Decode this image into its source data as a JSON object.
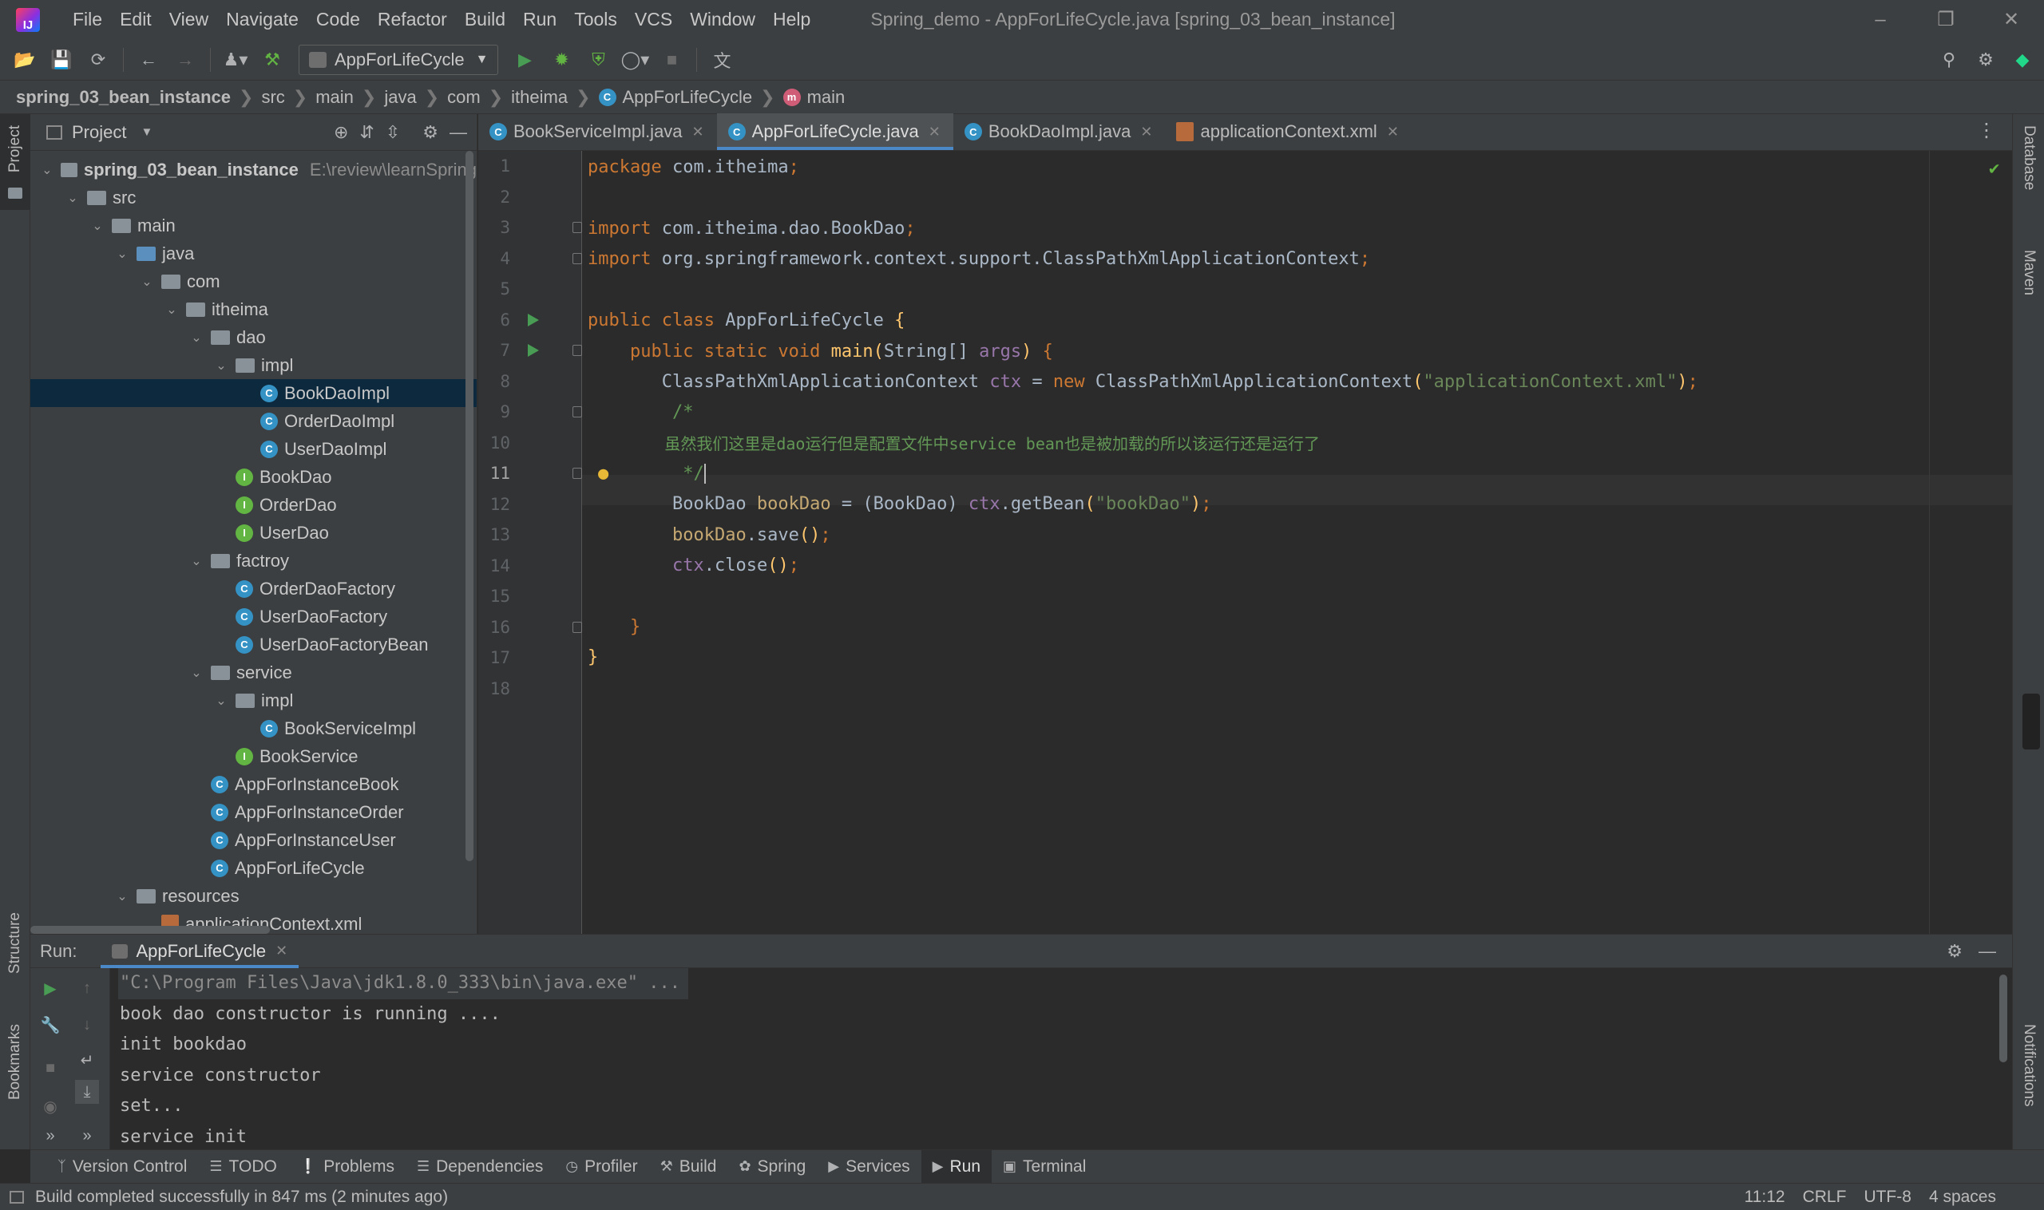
{
  "window": {
    "title": "Spring_demo - AppForLifeCycle.java [spring_03_bean_instance]",
    "menu": [
      "File",
      "Edit",
      "View",
      "Navigate",
      "Code",
      "Refactor",
      "Build",
      "Run",
      "Tools",
      "VCS",
      "Window",
      "Help"
    ]
  },
  "toolbar": {
    "run_config": "AppForLifeCycle"
  },
  "breadcrumb": [
    "spring_03_bean_instance",
    "src",
    "main",
    "java",
    "com",
    "itheima",
    "AppForLifeCycle",
    "main"
  ],
  "left_stripe": {
    "project": "Project",
    "structure": "Structure",
    "bookmarks": "Bookmarks"
  },
  "right_stripe": {
    "database": "Database",
    "maven": "Maven",
    "notifications": "Notifications"
  },
  "project": {
    "title": "Project",
    "root_name": "spring_03_bean_instance",
    "root_path": "E:\\review\\learnSpring",
    "tree": [
      {
        "label": "src",
        "indent": 1,
        "type": "folder",
        "open": true
      },
      {
        "label": "main",
        "indent": 2,
        "type": "folder",
        "open": true
      },
      {
        "label": "java",
        "indent": 3,
        "type": "folder-blue",
        "open": true
      },
      {
        "label": "com",
        "indent": 4,
        "type": "folder",
        "open": true
      },
      {
        "label": "itheima",
        "indent": 5,
        "type": "folder",
        "open": true
      },
      {
        "label": "dao",
        "indent": 6,
        "type": "folder",
        "open": true
      },
      {
        "label": "impl",
        "indent": 7,
        "type": "folder",
        "open": true
      },
      {
        "label": "BookDaoImpl",
        "indent": 8,
        "type": "class",
        "selected": true
      },
      {
        "label": "OrderDaoImpl",
        "indent": 8,
        "type": "class"
      },
      {
        "label": "UserDaoImpl",
        "indent": 8,
        "type": "class"
      },
      {
        "label": "BookDao",
        "indent": 7,
        "type": "interface"
      },
      {
        "label": "OrderDao",
        "indent": 7,
        "type": "interface"
      },
      {
        "label": "UserDao",
        "indent": 7,
        "type": "interface"
      },
      {
        "label": "factroy",
        "indent": 6,
        "type": "folder",
        "open": true
      },
      {
        "label": "OrderDaoFactory",
        "indent": 7,
        "type": "class"
      },
      {
        "label": "UserDaoFactory",
        "indent": 7,
        "type": "class"
      },
      {
        "label": "UserDaoFactoryBean",
        "indent": 7,
        "type": "class"
      },
      {
        "label": "service",
        "indent": 6,
        "type": "folder",
        "open": true
      },
      {
        "label": "impl",
        "indent": 7,
        "type": "folder",
        "open": true
      },
      {
        "label": "BookServiceImpl",
        "indent": 8,
        "type": "class"
      },
      {
        "label": "BookService",
        "indent": 7,
        "type": "interface"
      },
      {
        "label": "AppForInstanceBook",
        "indent": 6,
        "type": "class"
      },
      {
        "label": "AppForInstanceOrder",
        "indent": 6,
        "type": "class"
      },
      {
        "label": "AppForInstanceUser",
        "indent": 6,
        "type": "class"
      },
      {
        "label": "AppForLifeCycle",
        "indent": 6,
        "type": "class"
      },
      {
        "label": "resources",
        "indent": 3,
        "type": "folder",
        "open": true
      },
      {
        "label": "applicationContext.xml",
        "indent": 4,
        "type": "xml"
      }
    ]
  },
  "editor": {
    "tabs": [
      {
        "label": "BookServiceImpl.java",
        "active": false,
        "icon": "class"
      },
      {
        "label": "AppForLifeCycle.java",
        "active": true,
        "icon": "class"
      },
      {
        "label": "BookDaoImpl.java",
        "active": false,
        "icon": "class"
      },
      {
        "label": "applicationContext.xml",
        "active": false,
        "icon": "xml"
      }
    ],
    "current_line": 11,
    "line_numbers": [
      "1",
      "2",
      "3",
      "4",
      "5",
      "6",
      "7",
      "8",
      "9",
      "10",
      "11",
      "12",
      "13",
      "14",
      "15",
      "16",
      "17",
      "18"
    ]
  },
  "run": {
    "label": "Run:",
    "tab": "AppForLifeCycle",
    "console": [
      "\"C:\\Program Files\\Java\\jdk1.8.0_333\\bin\\java.exe\" ...",
      "book dao constructor is running ....",
      "init bookdao",
      "service constructor",
      "set...",
      "service init"
    ]
  },
  "bottom_tools": [
    "Version Control",
    "TODO",
    "Problems",
    "Dependencies",
    "Profiler",
    "Build",
    "Spring",
    "Services",
    "Run",
    "Terminal"
  ],
  "status": {
    "message": "Build completed successfully in 847 ms (2 minutes ago)",
    "position": "11:12",
    "line_sep": "CRLF",
    "encoding": "UTF-8",
    "indent": "4 spaces"
  }
}
